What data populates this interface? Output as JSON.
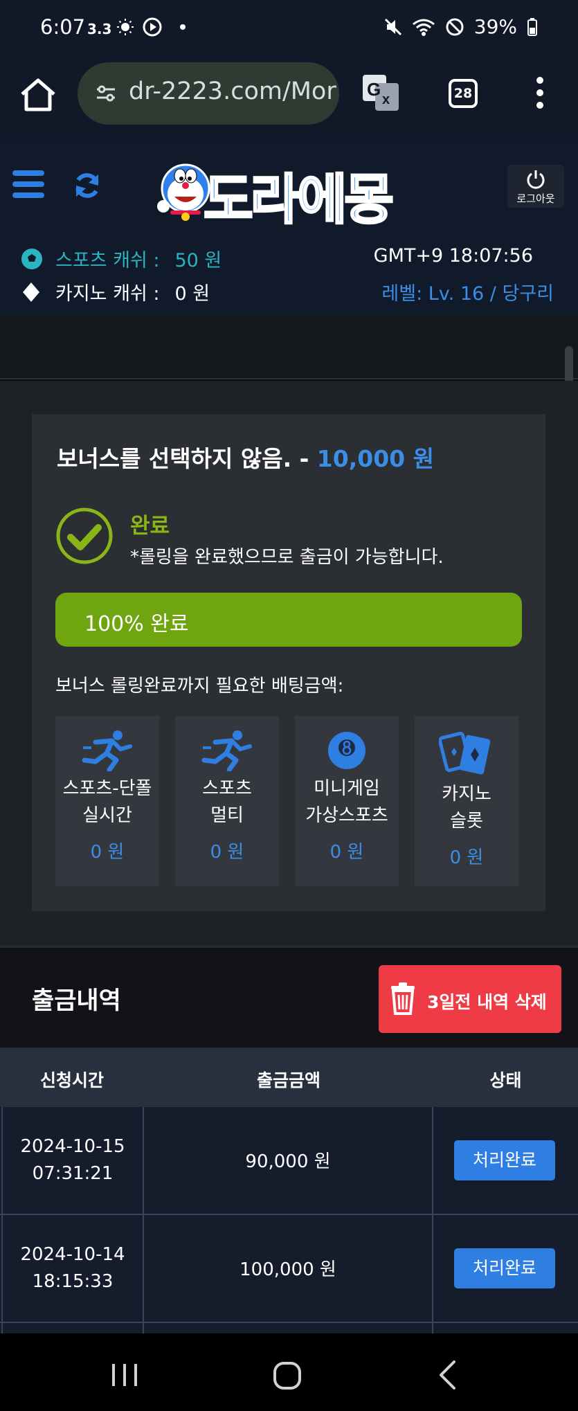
{
  "status_bar": {
    "time": "6:07",
    "extra": "3.3",
    "battery": "39%"
  },
  "browser": {
    "url": "dr-2223.com/Mor",
    "tab_count": "28"
  },
  "header": {
    "logo_text": "도라에몽",
    "logout_label": "로그아웃",
    "sports_cash_label": "스포츠 캐쉬 :",
    "sports_cash_value": "50 원",
    "casino_cash_label": "카지노 캐쉬 :",
    "casino_cash_value": "0 원",
    "clock": "GMT+9 18:07:56",
    "level": "레벨: Lv. 16 / 당구리"
  },
  "bonus": {
    "title_prefix": "보너스를 선택하지 않음. - ",
    "title_amount": "10,000 원",
    "status_label": "완료",
    "status_desc": "*롤링을 완료했으므로 출금이 가능합니다.",
    "progress_percent": 100,
    "progress_label": "100% 완료",
    "needed_label": "보너스 롤링완료까지 필요한 배팅금액:",
    "categories": [
      {
        "line1": "스포츠-단폴",
        "line2": "실시간",
        "value": "0 원",
        "icon": "running-icon"
      },
      {
        "line1": "스포츠",
        "line2": "멀티",
        "value": "0 원",
        "icon": "running-icon"
      },
      {
        "line1": "미니게임",
        "line2": "가상스포츠",
        "value": "0 원",
        "icon": "8-ball-icon"
      },
      {
        "line1": "카지노",
        "line2": "슬롯",
        "value": "0 원",
        "icon": "cards-icon"
      }
    ]
  },
  "history": {
    "title": "출금내역",
    "delete_label": "3일전 내역 삭제",
    "columns": [
      "신청시간",
      "출금금액",
      "상태"
    ],
    "rows": [
      {
        "date": "2024-10-15",
        "time": "07:31:21",
        "amount": "90,000 원",
        "status": "처리완료"
      },
      {
        "date": "2024-10-14",
        "time": "18:15:33",
        "amount": "100,000 원",
        "status": "처리완료"
      }
    ]
  },
  "colors": {
    "accent_blue": "#3a8ee6",
    "accent_green": "#6fa50f",
    "accent_teal": "#2bb3c0",
    "danger_red": "#ef3b45"
  }
}
